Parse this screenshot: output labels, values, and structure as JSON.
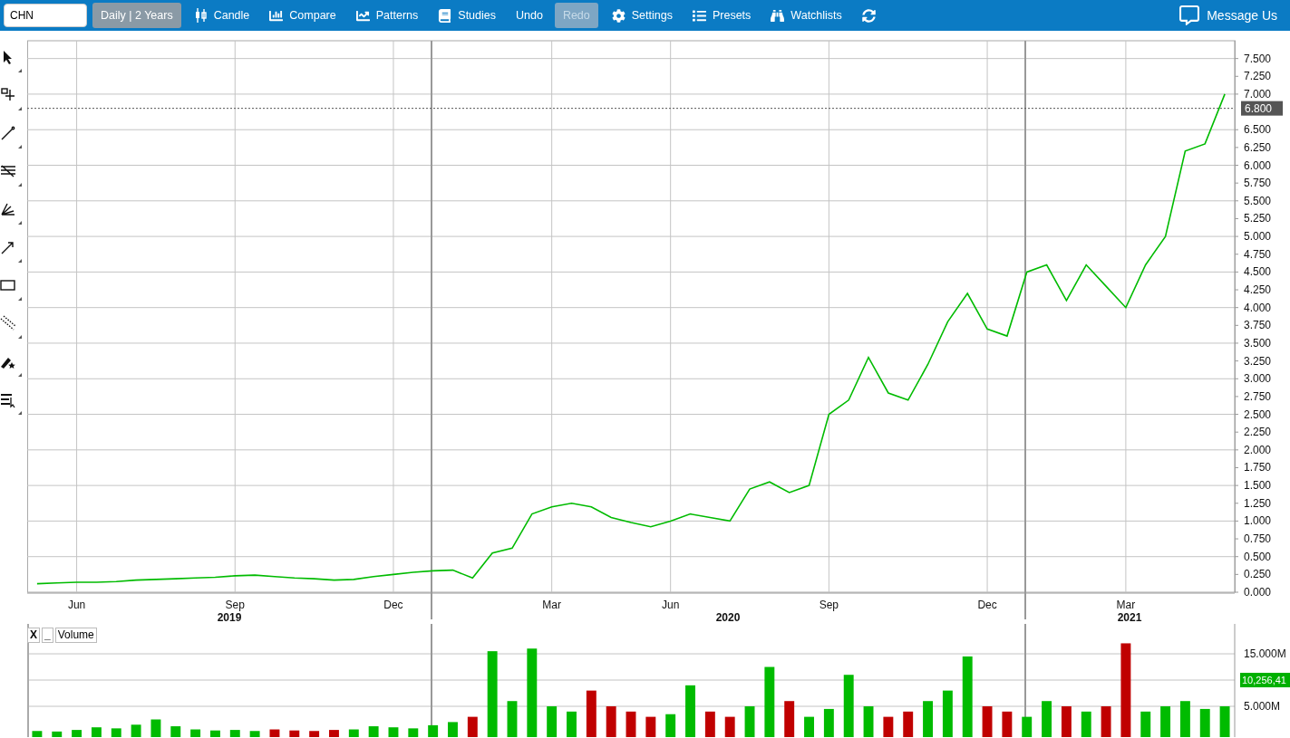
{
  "toolbar": {
    "symbol_field": {
      "value": "CHN"
    },
    "items": [
      {
        "kind": "dropdown",
        "label": "Daily | 2 Years",
        "disabled": false
      },
      {
        "kind": "button",
        "label": "Candle",
        "disabled": false
      },
      {
        "kind": "button",
        "label": "Compare",
        "disabled": false
      },
      {
        "kind": "button",
        "label": "Patterns",
        "disabled": false
      },
      {
        "kind": "button",
        "label": "Studies",
        "disabled": false
      },
      {
        "kind": "button",
        "label": "Undo",
        "disabled": false
      },
      {
        "kind": "button",
        "label": "Redo",
        "disabled": true
      },
      {
        "kind": "button",
        "label": "Settings",
        "disabled": false
      },
      {
        "kind": "button",
        "label": "Presets",
        "disabled": false
      },
      {
        "kind": "button",
        "label": "Watchlists",
        "disabled": false
      },
      {
        "kind": "icon",
        "disabled": false
      }
    ],
    "message_button": {
      "label": "Message Us"
    }
  },
  "price_panel": {
    "year_labels": [
      "2019",
      "2020",
      "2021"
    ],
    "chart_data": {
      "type": "line",
      "ylim": [
        0,
        7.75
      ],
      "grid": true,
      "categories": [
        null,
        null,
        "Jun",
        null,
        null,
        null,
        null,
        null,
        null,
        null,
        "Sep",
        null,
        null,
        null,
        null,
        null,
        null,
        null,
        "Dec",
        null,
        null,
        null,
        null,
        null,
        null,
        null,
        "Mar",
        null,
        null,
        null,
        null,
        null,
        "Jun",
        null,
        null,
        null,
        null,
        null,
        null,
        null,
        "Sep",
        null,
        null,
        null,
        null,
        null,
        null,
        null,
        "Dec",
        null,
        null,
        null,
        null,
        null,
        null,
        "Mar",
        null,
        null,
        null,
        null,
        null
      ],
      "yticks": [
        {
          "value": 0,
          "label": "0.000"
        },
        {
          "value": 0.25,
          "label": "0.250"
        },
        {
          "value": 0.5,
          "label": "0.500"
        },
        {
          "value": 0.75,
          "label": "0.750"
        },
        {
          "value": 1,
          "label": "1.000"
        },
        {
          "value": 1.25,
          "label": "1.250"
        },
        {
          "value": 1.5,
          "label": "1.500"
        },
        {
          "value": 1.75,
          "label": "1.750"
        },
        {
          "value": 2,
          "label": "2.000"
        },
        {
          "value": 2.25,
          "label": "2.250"
        },
        {
          "value": 2.5,
          "label": "2.500"
        },
        {
          "value": 2.75,
          "label": "2.750"
        },
        {
          "value": 3,
          "label": "3.000"
        },
        {
          "value": 3.25,
          "label": "3.250"
        },
        {
          "value": 3.5,
          "label": "3.500"
        },
        {
          "value": 3.75,
          "label": "3.750"
        },
        {
          "value": 4,
          "label": "4.000"
        },
        {
          "value": 4.25,
          "label": "4.250"
        },
        {
          "value": 4.5,
          "label": "4.500"
        },
        {
          "value": 4.75,
          "label": "4.750"
        },
        {
          "value": 5,
          "label": "5.000"
        },
        {
          "value": 5.25,
          "label": "5.250"
        },
        {
          "value": 5.5,
          "label": "5.500"
        },
        {
          "value": 5.75,
          "label": "5.750"
        },
        {
          "value": 6,
          "label": "6.000"
        },
        {
          "value": 6.25,
          "label": "6.250"
        },
        {
          "value": 6.5,
          "label": "6.500"
        },
        {
          "value": 7,
          "label": "7.000"
        },
        {
          "value": 7.25,
          "label": "7.250"
        },
        {
          "value": 7.5,
          "label": "7.500"
        }
      ],
      "series": [
        {
          "color": "#00bb00",
          "values": [
            0.12,
            0.13,
            0.14,
            0.14,
            0.15,
            0.17,
            0.18,
            0.19,
            0.2,
            0.21,
            0.23,
            0.24,
            0.22,
            0.2,
            0.19,
            0.17,
            0.18,
            0.22,
            0.25,
            0.28,
            0.3,
            0.31,
            0.2,
            0.55,
            0.62,
            1.1,
            1.2,
            1.25,
            1.2,
            1.05,
            0.98,
            0.92,
            1.0,
            1.1,
            1.05,
            1.0,
            1.45,
            1.55,
            1.4,
            1.5,
            2.5,
            2.7,
            3.3,
            2.8,
            2.7,
            3.2,
            3.8,
            4.2,
            3.7,
            3.6,
            4.5,
            4.6,
            4.1,
            4.6,
            4.3,
            4.0,
            4.6,
            5.0,
            6.2,
            6.3,
            7.0
          ]
        }
      ],
      "ref_lines": [
        {
          "axis": "y",
          "value": 6.8,
          "label": "6.800"
        }
      ]
    }
  },
  "volume_panel": {
    "close_label": "X",
    "minimize_label": "_",
    "title": "Volume",
    "last_volume": "10,256,41",
    "chart_data": {
      "type": "bar",
      "ylim": [
        0,
        20.7
      ],
      "grid": true,
      "categories": [
        null,
        null,
        null,
        null,
        null,
        null,
        null,
        null,
        null,
        null,
        null,
        null,
        null,
        null,
        null,
        null,
        null,
        null,
        null,
        null,
        null,
        null,
        null,
        null,
        null,
        null,
        null,
        null,
        null,
        null,
        null,
        null,
        null,
        null,
        null,
        null,
        null,
        null,
        null,
        null,
        null,
        null,
        null,
        null,
        null,
        null,
        null,
        null,
        null,
        null,
        null,
        null,
        null,
        null,
        null,
        null,
        null,
        null,
        null,
        null,
        null
      ],
      "yticks": [
        {
          "value": 5,
          "label": "5.000M"
        },
        {
          "value": 15,
          "label": "15.000M"
        }
      ],
      "series": [
        {
          "color": "#00bb00",
          "values": [
            0.3,
            0.2,
            0.5,
            1.0,
            0.8,
            1.5,
            2.5,
            1.2,
            0.6,
            0.4,
            0.5,
            0.3,
            null,
            null,
            null,
            null,
            0.6,
            1.2,
            1.0,
            0.8,
            1.4,
            2.0,
            null,
            15.5,
            6,
            16,
            5,
            4,
            null,
            null,
            null,
            null,
            3.5,
            9,
            null,
            null,
            5,
            12.5,
            null,
            3,
            4.5,
            11,
            5,
            null,
            null,
            6,
            8,
            14.5,
            null,
            null,
            3,
            6,
            null,
            4,
            null,
            null,
            4,
            5,
            6,
            4.5,
            5
          ]
        },
        {
          "color": "#c00000",
          "values": [
            null,
            null,
            null,
            null,
            null,
            null,
            null,
            null,
            null,
            null,
            null,
            null,
            0.6,
            0.4,
            0.3,
            0.5,
            null,
            null,
            null,
            null,
            null,
            null,
            3.0,
            null,
            null,
            null,
            null,
            null,
            8,
            5,
            4,
            3,
            null,
            null,
            4,
            3,
            null,
            null,
            6,
            null,
            null,
            null,
            null,
            3,
            4,
            null,
            null,
            null,
            5,
            4,
            null,
            null,
            5,
            null,
            5,
            17,
            null,
            null,
            null,
            null,
            null
          ]
        }
      ]
    }
  }
}
